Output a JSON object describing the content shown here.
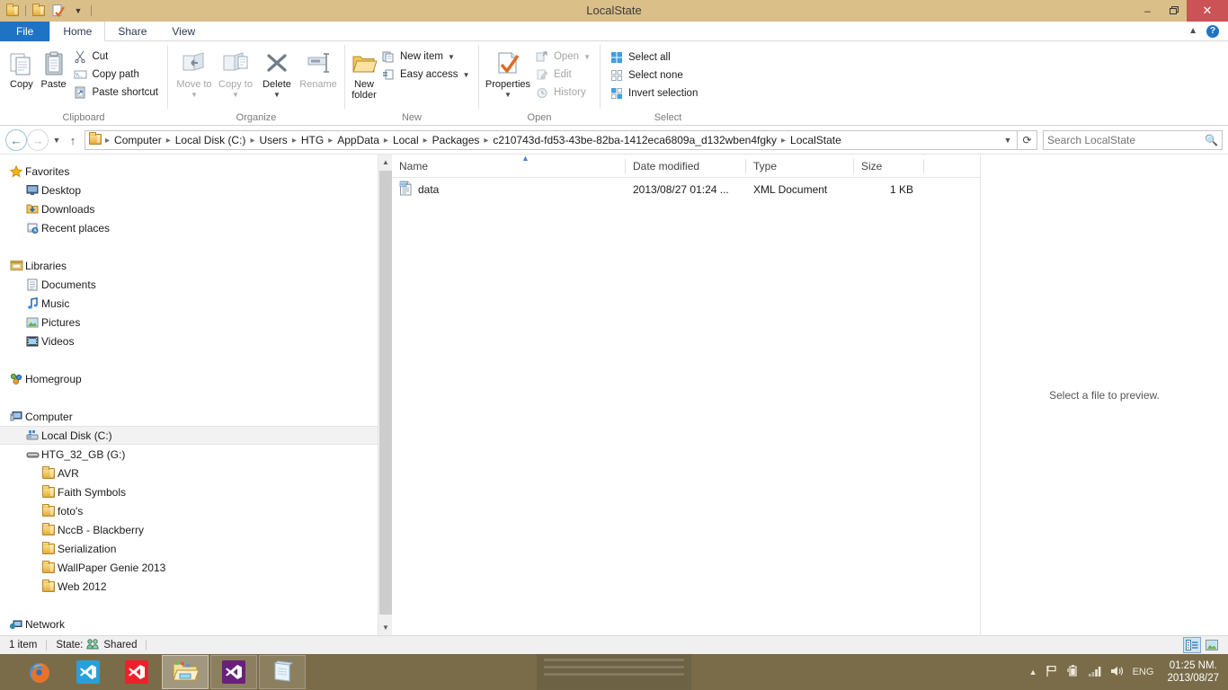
{
  "window": {
    "title": "LocalState",
    "quick_access": [
      "folder-icon",
      "folder-icon",
      "properties-icon"
    ],
    "minimize_label": "–",
    "maximize_label": "❐",
    "close_label": "✕"
  },
  "tabs": [
    {
      "label": "File",
      "type": "file"
    },
    {
      "label": "Home",
      "type": "active"
    },
    {
      "label": "Share",
      "type": "normal"
    },
    {
      "label": "View",
      "type": "normal"
    }
  ],
  "tab_right": {
    "collapse_icon": "chevron-up-icon",
    "help_icon": "help-icon",
    "help_label": "?"
  },
  "ribbon": {
    "groups": [
      {
        "name": "Clipboard",
        "big_buttons": [
          {
            "label": "Copy",
            "icon": "copy-icon",
            "disabled": false
          },
          {
            "label": "Paste",
            "icon": "paste-icon",
            "disabled": false
          }
        ],
        "small_buttons": [
          {
            "label": "Cut",
            "icon": "scissors-icon",
            "disabled": false
          },
          {
            "label": "Copy path",
            "icon": "copy-path-icon",
            "disabled": false
          },
          {
            "label": "Paste shortcut",
            "icon": "paste-shortcut-icon",
            "disabled": false
          }
        ]
      },
      {
        "name": "Organize",
        "big_buttons": [
          {
            "label": "Move to",
            "icon": "move-to-icon",
            "disabled": true,
            "caret": true
          },
          {
            "label": "Copy to",
            "icon": "copy-to-icon",
            "disabled": true,
            "caret": true
          },
          {
            "label": "Delete",
            "icon": "delete-x-icon",
            "disabled": false,
            "caret": true
          },
          {
            "label": "Rename",
            "icon": "rename-icon",
            "disabled": true
          }
        ]
      },
      {
        "name": "New",
        "big_buttons": [
          {
            "label": "New folder",
            "icon": "new-folder-icon",
            "disabled": false
          }
        ],
        "small_buttons": [
          {
            "label": "New item",
            "icon": "new-item-icon",
            "disabled": false,
            "caret": true
          },
          {
            "label": "Easy access",
            "icon": "easy-access-icon",
            "disabled": false,
            "caret": true
          }
        ]
      },
      {
        "name": "Open",
        "big_buttons": [
          {
            "label": "Properties",
            "icon": "properties-icon",
            "disabled": false,
            "caret": true
          }
        ],
        "small_buttons": [
          {
            "label": "Open",
            "icon": "open-icon",
            "disabled": true,
            "caret": true
          },
          {
            "label": "Edit",
            "icon": "edit-icon",
            "disabled": true
          },
          {
            "label": "History",
            "icon": "history-icon",
            "disabled": true
          }
        ]
      },
      {
        "name": "Select",
        "small_buttons": [
          {
            "label": "Select all",
            "icon": "select-all-icon",
            "disabled": false
          },
          {
            "label": "Select none",
            "icon": "select-none-icon",
            "disabled": false
          },
          {
            "label": "Invert selection",
            "icon": "invert-selection-icon",
            "disabled": false
          }
        ]
      }
    ]
  },
  "address_bar": {
    "back_icon": "arrow-left-icon",
    "forward_icon": "arrow-right-icon",
    "recent_icon": "chevron-down-icon",
    "up_icon": "arrow-up-icon",
    "folder_icon": "folder-icon",
    "breadcrumbs": [
      "Computer",
      "Local Disk (C:)",
      "Users",
      "HTG",
      "AppData",
      "Local",
      "Packages",
      "c210743d-fd53-43be-82ba-1412eca6809a_d132wben4fgky",
      "LocalState"
    ],
    "dropdown_icon": "chevron-down-icon",
    "refresh_icon": "refresh-icon",
    "search_placeholder": "Search LocalState",
    "search_value": "",
    "search_icon": "search-icon"
  },
  "nav_pane": {
    "items": [
      {
        "label": "Favorites",
        "icon": "star-icon",
        "level": 1,
        "selected": false
      },
      {
        "label": "Desktop",
        "icon": "desktop-icon",
        "level": 2,
        "selected": false
      },
      {
        "label": "Downloads",
        "icon": "downloads-icon",
        "level": 2,
        "selected": false
      },
      {
        "label": "Recent places",
        "icon": "recent-places-icon",
        "level": 2,
        "selected": false
      },
      {
        "label": "",
        "icon": "spacer",
        "level": 0,
        "selected": false
      },
      {
        "label": "Libraries",
        "icon": "libraries-icon",
        "level": 1,
        "selected": false
      },
      {
        "label": "Documents",
        "icon": "documents-icon",
        "level": 2,
        "selected": false
      },
      {
        "label": "Music",
        "icon": "music-icon",
        "level": 2,
        "selected": false
      },
      {
        "label": "Pictures",
        "icon": "pictures-icon",
        "level": 2,
        "selected": false
      },
      {
        "label": "Videos",
        "icon": "videos-icon",
        "level": 2,
        "selected": false
      },
      {
        "label": "",
        "icon": "spacer",
        "level": 0,
        "selected": false
      },
      {
        "label": "Homegroup",
        "icon": "homegroup-icon",
        "level": 1,
        "selected": false
      },
      {
        "label": "",
        "icon": "spacer",
        "level": 0,
        "selected": false
      },
      {
        "label": "Computer",
        "icon": "computer-icon",
        "level": 1,
        "selected": false
      },
      {
        "label": "Local Disk (C:)",
        "icon": "harddisk-icon",
        "level": 2,
        "selected": true
      },
      {
        "label": "HTG_32_GB (G:)",
        "icon": "usbdrive-icon",
        "level": 2,
        "selected": false
      },
      {
        "label": "AVR",
        "icon": "folder-icon",
        "level": 3,
        "selected": false
      },
      {
        "label": "Faith Symbols",
        "icon": "folder-icon",
        "level": 3,
        "selected": false
      },
      {
        "label": "foto's",
        "icon": "folder-icon",
        "level": 3,
        "selected": false
      },
      {
        "label": "NccB - Blackberry",
        "icon": "folder-icon",
        "level": 3,
        "selected": false
      },
      {
        "label": "Serialization",
        "icon": "folder-icon",
        "level": 3,
        "selected": false
      },
      {
        "label": "WallPaper Genie 2013",
        "icon": "folder-icon",
        "level": 3,
        "selected": false
      },
      {
        "label": "Web 2012",
        "icon": "folder-icon",
        "level": 3,
        "selected": false
      },
      {
        "label": "",
        "icon": "spacer",
        "level": 0,
        "selected": false
      },
      {
        "label": "Network",
        "icon": "network-icon",
        "level": 1,
        "selected": false
      }
    ],
    "scroll_up_icon": "chevron-up-icon",
    "scroll_down_icon": "chevron-down-icon"
  },
  "file_list": {
    "columns": [
      "Name",
      "Date modified",
      "Type",
      "Size"
    ],
    "sort_column": "Name",
    "sort_direction": "ascending",
    "rows": [
      {
        "name": "data",
        "icon": "xml-document-icon",
        "date_modified": "2013/08/27 01:24 ...",
        "type": "XML Document",
        "size": "1 KB"
      }
    ]
  },
  "preview_pane": {
    "message": "Select a file to preview."
  },
  "status_bar": {
    "item_count": "1 item",
    "state_label": "State:",
    "state_value": "Shared",
    "state_icon": "shared-people-icon",
    "details_view_icon": "details-view-icon",
    "large_icons_view_icon": "large-icons-view-icon"
  },
  "taskbar": {
    "buttons": [
      {
        "name": "firefox",
        "label": "Firefox",
        "state": "pinned"
      },
      {
        "name": "visual-studio-blue",
        "label": "Visual Studio",
        "state": "pinned",
        "color": "#26a0da"
      },
      {
        "name": "visual-studio-red",
        "label": "Visual Studio",
        "state": "pinned",
        "color": "#ef1f2b"
      },
      {
        "name": "file-explorer",
        "label": "File Explorer",
        "state": "active"
      },
      {
        "name": "visual-studio-purple",
        "label": "Visual Studio",
        "state": "open",
        "color": "#68217a"
      },
      {
        "name": "notepad",
        "label": "Notepad",
        "state": "open"
      }
    ],
    "tray": {
      "show_hidden_icon": "chevron-up-icon",
      "flag_icon": "action-center-icon",
      "battery_icon": "battery-icon",
      "network_icon": "network-bars-icon",
      "volume_icon": "volume-icon",
      "language": "ENG",
      "time": "01:25 NM.",
      "date": "2013/08/27"
    }
  },
  "colors": {
    "titlebar": "#dbbf89",
    "close_button": "#cb5355",
    "file_tab": "#1f73c4",
    "taskbar": "#7a6c49",
    "selection": "#f2f2f2"
  }
}
